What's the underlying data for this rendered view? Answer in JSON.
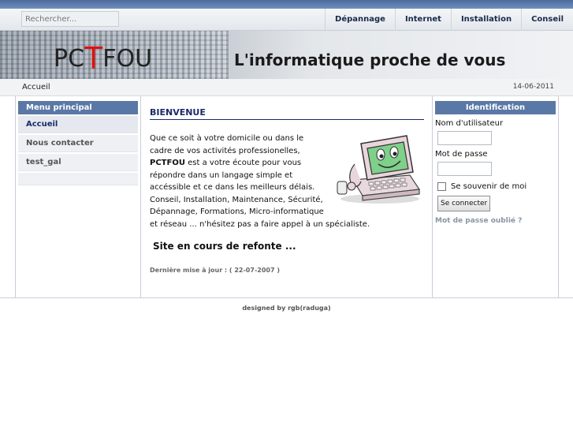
{
  "search": {
    "placeholder": "Rechercher..."
  },
  "topnav": [
    "Dépannage",
    "Internet",
    "Installation",
    "Conseil"
  ],
  "banner": {
    "logo_pre": "PC",
    "logo_t": "T",
    "logo_post": "FOU",
    "tagline": "L'informatique proche de vous"
  },
  "breadcrumb": {
    "current": "Accueil",
    "date": "14-06-2011"
  },
  "left_menu": {
    "title": "Menu principal",
    "items": [
      "Accueil",
      "Nous contacter",
      "test_gal"
    ],
    "active_index": 0
  },
  "content": {
    "heading": "BIENVENUE",
    "intro_before": "Que ce soit à votre domicile ou dans le cadre de vos activités professionelles, ",
    "intro_brand": "PCTFOU",
    "intro_after": "  est a votre écoute pour vous répondre dans un langage simple et accéssible et ce dans les meilleurs délais. Conseil, Installation, Maintenance, Sécurité, Dépannage, Formations, Micro-informatique et réseau ... n'hésitez pas a faire appel à un spécialiste.",
    "notice": "Site en cours de refonte ...",
    "last_update": "Dernière mise à jour : ( 22-07-2007 )"
  },
  "login": {
    "title": "Identification",
    "username_label": "Nom d'utilisateur",
    "password_label": "Mot de passe",
    "remember_label": "Se souvenir de moi",
    "submit_label": "Se connecter",
    "forgot_label": "Mot de passe oublié ?"
  },
  "footer": {
    "credit": "designed by rgb(raduga)"
  },
  "colors": {
    "accent": "#5a78a6",
    "logo_red": "#dd1111",
    "heading": "#1a2a6a"
  }
}
